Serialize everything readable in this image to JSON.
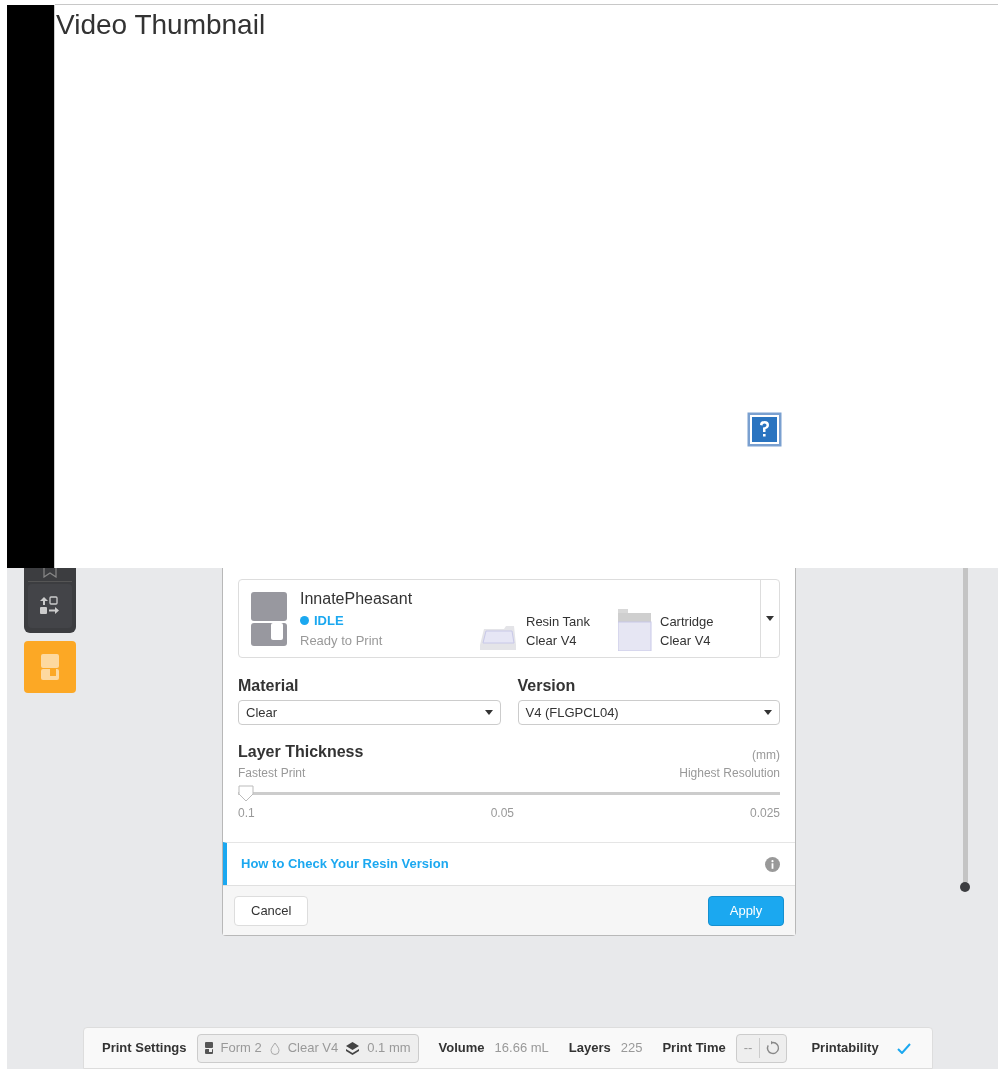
{
  "video": {
    "title": "Video Thumbnail"
  },
  "printer": {
    "name": "InnatePheasant",
    "status": "IDLE",
    "detail": "Ready to Print",
    "parts": [
      {
        "kind": "tank",
        "label": "Resin Tank",
        "value": "Clear V4"
      },
      {
        "kind": "cartridge",
        "label": "Cartridge",
        "value": "Clear V4"
      }
    ]
  },
  "material": {
    "label": "Material",
    "value": "Clear"
  },
  "version": {
    "label": "Version",
    "value": "V4 (FLGPCL04)"
  },
  "layer_thickness": {
    "label": "Layer Thickness",
    "unit": "(mm)",
    "min_label": "Fastest Print",
    "max_label": "Highest Resolution",
    "level": 0,
    "ticks": [
      "0.1",
      "0.05",
      "0.025"
    ]
  },
  "help_link": "How to Check Your Resin Version",
  "buttons": {
    "cancel": "Cancel",
    "apply": "Apply"
  },
  "status_bar": {
    "print_settings": {
      "label": "Print Settings",
      "printer": "Form 2",
      "material": "Clear V4",
      "layer": "0.1 mm"
    },
    "volume": {
      "label": "Volume",
      "value": "16.66 mL"
    },
    "layers": {
      "label": "Layers",
      "value": "225"
    },
    "print_time": {
      "label": "Print Time",
      "value": "--"
    },
    "printability": {
      "label": "Printability",
      "ok": true
    }
  }
}
